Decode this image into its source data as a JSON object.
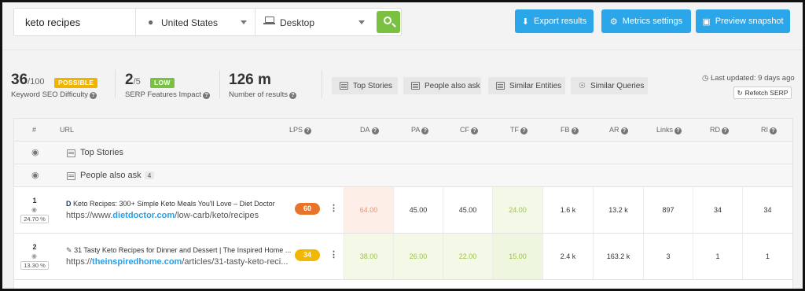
{
  "search": {
    "keyword": "keto recipes",
    "location": "United States",
    "device": "Desktop"
  },
  "toolbar": {
    "export_label": "Export results",
    "metrics_label": "Metrics settings",
    "snapshot_label": "Preview snapshot"
  },
  "stats": {
    "kd_value": "36",
    "kd_max": "/100",
    "kd_badge": "POSSIBLE",
    "kd_label": "Keyword SEO Difficulty",
    "sfi_value": "2",
    "sfi_max": "/5",
    "sfi_badge": "LOW",
    "sfi_label": "SERP Features Impact",
    "results_value": "126 m",
    "results_label": "Number of results"
  },
  "features": [
    "Top Stories",
    "People also ask",
    "Similar Entities",
    "Similar Queries"
  ],
  "updated": {
    "text": "Last updated: 9 days ago",
    "refetch_label": "Refetch SERP"
  },
  "table": {
    "headers": {
      "num": "#",
      "url": "URL",
      "lps": "LPS",
      "da": "DA",
      "pa": "PA",
      "cf": "CF",
      "tf": "TF",
      "fb": "FB",
      "ar": "AR",
      "links": "Links",
      "rd": "RD",
      "ri": "RI"
    },
    "groups": [
      {
        "label": "Top Stories"
      },
      {
        "label": "People also ask",
        "count": "4"
      }
    ],
    "rows": [
      {
        "rank": "1",
        "pct": "24.70 %",
        "title": "Keto Recipes: 300+ Simple Keto Meals You'll Love – Diet Doctor",
        "url_prefix": "https://www.",
        "url_domain": "dietdoctor.com",
        "url_path": "/low-carb/keto/recipes",
        "lps": "60",
        "da": "64.00",
        "pa": "45.00",
        "cf": "45.00",
        "tf": "24.00",
        "fb": "1.6 k",
        "ar": "13.2 k",
        "links": "897",
        "rd": "34",
        "ri": "34"
      },
      {
        "rank": "2",
        "pct": "13.30 %",
        "title": "31 Tasty Keto Recipes for Dinner and Dessert | The Inspired Home ...",
        "url_prefix": "https://",
        "url_domain": "theinspiredhome.com",
        "url_path": "/articles/31-tasty-keto-reci...",
        "lps": "34",
        "da": "38.00",
        "pa": "26.00",
        "cf": "22.00",
        "tf": "15.00",
        "fb": "2.4 k",
        "ar": "163.2 k",
        "links": "3",
        "rd": "1",
        "ri": "1"
      }
    ]
  },
  "colors": {
    "primary_blue": "#2ba6e8",
    "search_green": "#7ac142",
    "badge_possible": "#f0b400",
    "badge_low": "#7ac142",
    "lps_orange": "#e8742a",
    "lps_yellow": "#f2b705",
    "metric_red": "#e8907a",
    "metric_green": "#9bc43c"
  }
}
